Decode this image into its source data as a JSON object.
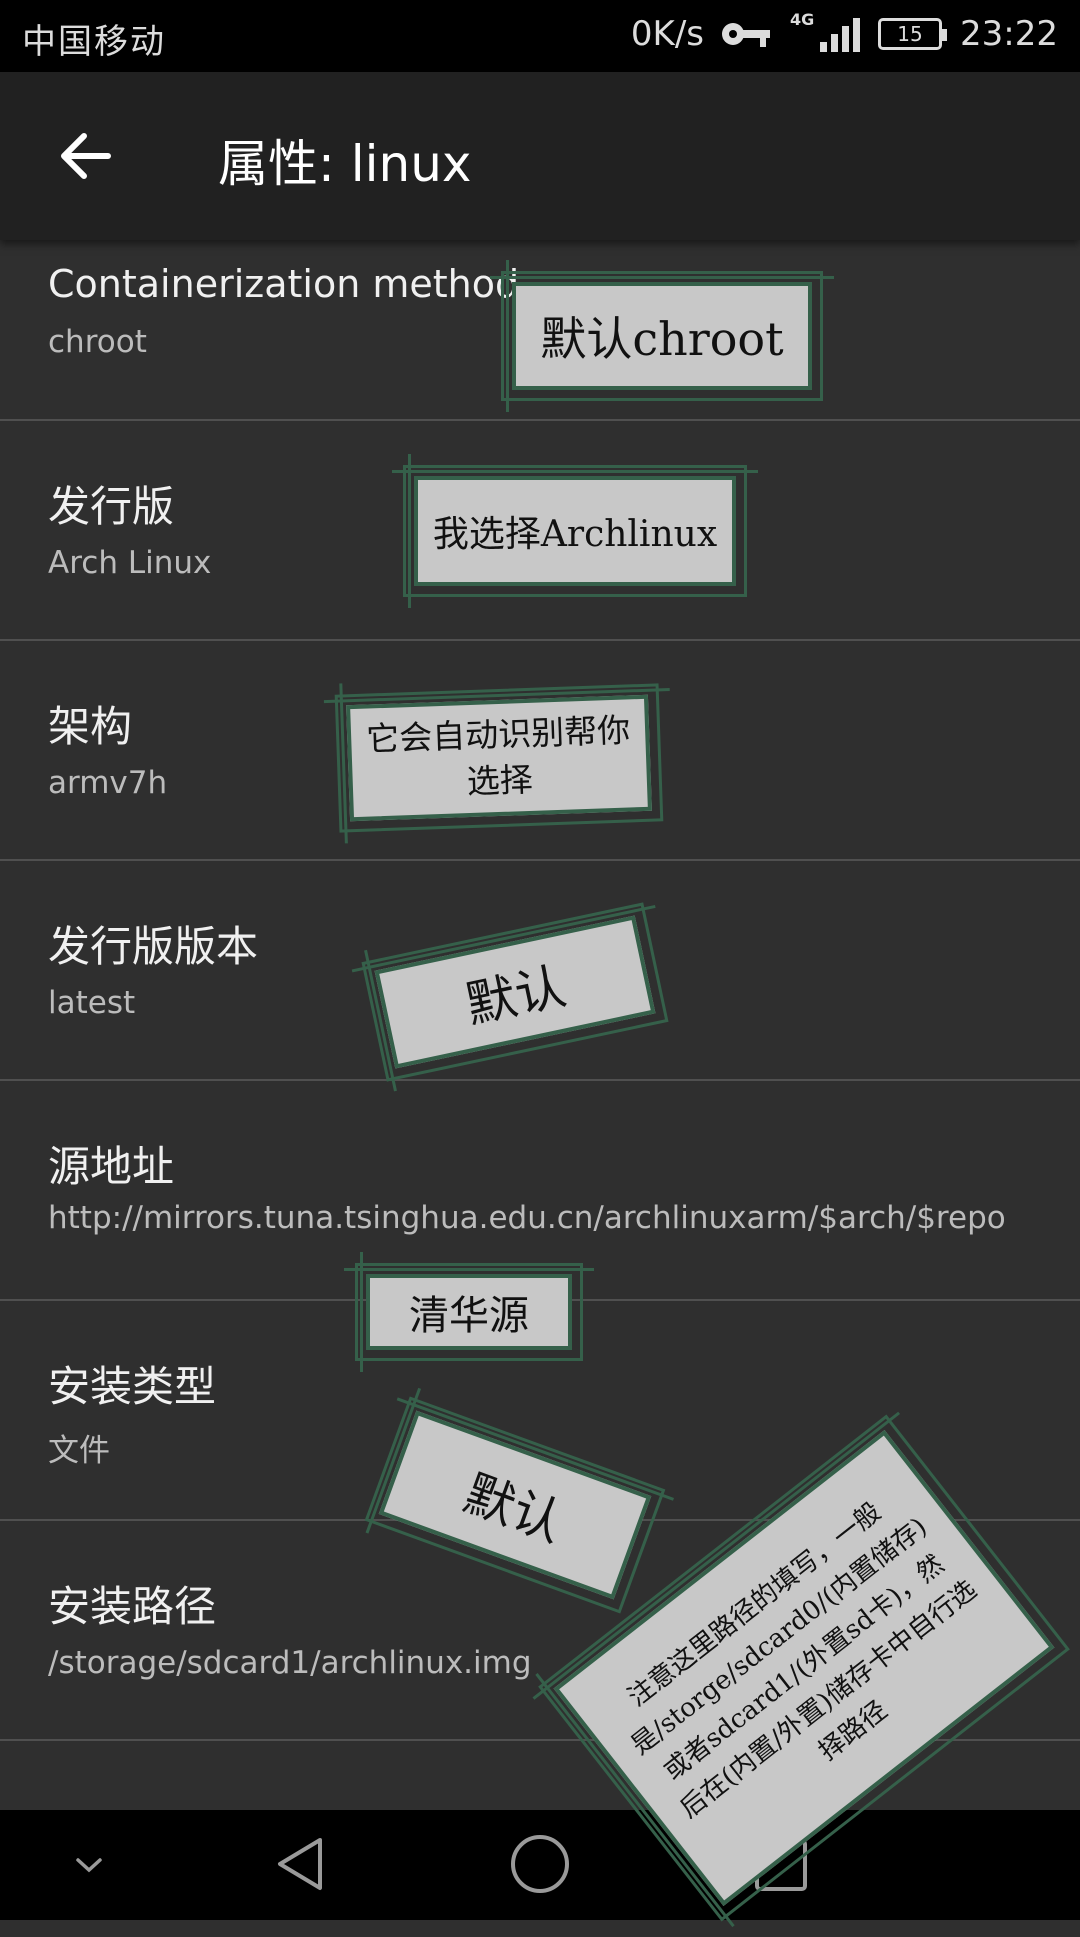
{
  "status": {
    "carrier": "中国移动",
    "speed": "0K/s",
    "network": "4G",
    "battery": "15",
    "time": "23:22"
  },
  "toolbar": {
    "title": "属性: linux"
  },
  "rows": [
    {
      "label": "Containerization method",
      "value": "chroot"
    },
    {
      "label": "发行版",
      "value": "Arch Linux"
    },
    {
      "label": "架构",
      "value": "armv7h"
    },
    {
      "label": "发行版版本",
      "value": "latest"
    },
    {
      "label": "源地址",
      "value": "http://mirrors.tuna.tsinghua.edu.cn/archlinuxarm/$arch/$repo"
    },
    {
      "label": "安装类型",
      "value": "文件"
    },
    {
      "label": "安装路径",
      "value": "/storage/sdcard1/archlinux.img"
    }
  ],
  "notes": {
    "default_chroot": "默认chroot",
    "choose_arch": "我选择Archlinux",
    "auto_arch": "它会自动识别帮你选择",
    "default_version": "默认",
    "tsinghua": "清华源",
    "default_type": "默认",
    "path_hint": "注意这里路径的填写，一般是/storge/sdcard0/(内置储存)或者sdcard1/(外置sd卡)，然后在(内置/外置)储存卡中自行选择路径"
  },
  "colors": {
    "background": "#2f2f2f",
    "toolbar": "#212121",
    "note_border": "#35604a",
    "note_fill": "#c8c8c8"
  },
  "icons": {
    "back": "arrow-left-icon",
    "nav_down": "chevron-down-icon",
    "nav_back": "triangle-back-icon",
    "nav_home": "circle-home-icon",
    "nav_recent": "square-recent-icon"
  }
}
